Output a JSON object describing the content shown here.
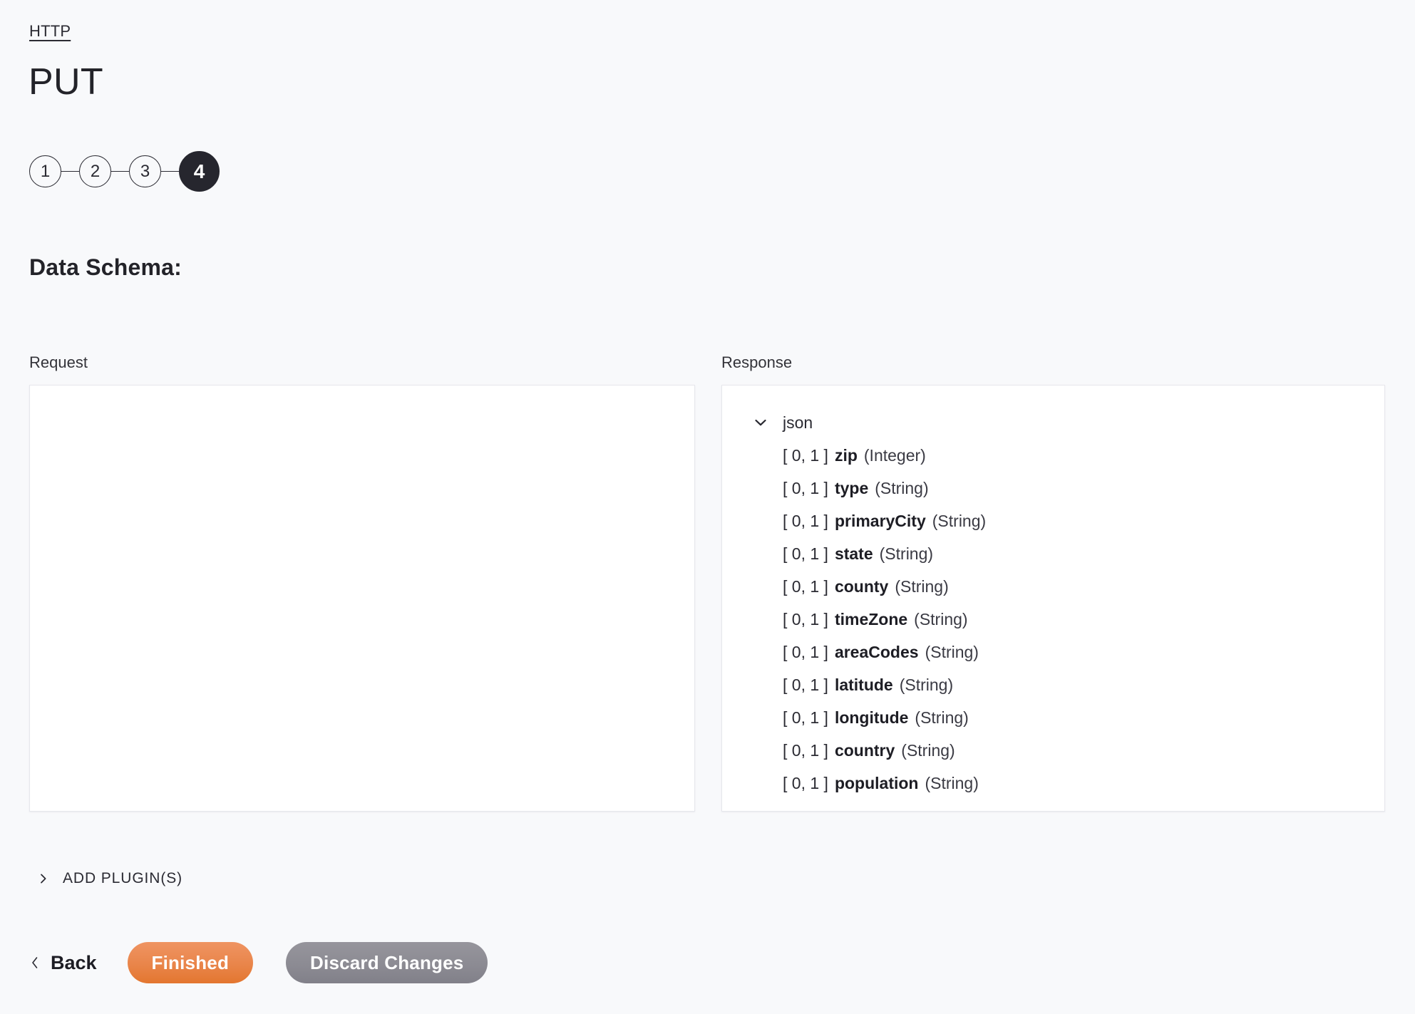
{
  "breadcrumb": {
    "label": "HTTP"
  },
  "page": {
    "title": "PUT"
  },
  "stepper": {
    "steps": [
      {
        "label": "1",
        "active": false
      },
      {
        "label": "2",
        "active": false
      },
      {
        "label": "3",
        "active": false
      },
      {
        "label": "4",
        "active": true
      }
    ]
  },
  "schema": {
    "heading": "Data Schema:",
    "request": {
      "label": "Request",
      "content": ""
    },
    "response": {
      "label": "Response",
      "root_label": "json",
      "root_icon": "chevron-down-icon",
      "fields": [
        {
          "cardinality": "[ 0, 1 ]",
          "name": "zip",
          "type": "(Integer)"
        },
        {
          "cardinality": "[ 0, 1 ]",
          "name": "type",
          "type": "(String)"
        },
        {
          "cardinality": "[ 0, 1 ]",
          "name": "primaryCity",
          "type": "(String)"
        },
        {
          "cardinality": "[ 0, 1 ]",
          "name": "state",
          "type": "(String)"
        },
        {
          "cardinality": "[ 0, 1 ]",
          "name": "county",
          "type": "(String)"
        },
        {
          "cardinality": "[ 0, 1 ]",
          "name": "timeZone",
          "type": "(String)"
        },
        {
          "cardinality": "[ 0, 1 ]",
          "name": "areaCodes",
          "type": "(String)"
        },
        {
          "cardinality": "[ 0, 1 ]",
          "name": "latitude",
          "type": "(String)"
        },
        {
          "cardinality": "[ 0, 1 ]",
          "name": "longitude",
          "type": "(String)"
        },
        {
          "cardinality": "[ 0, 1 ]",
          "name": "country",
          "type": "(String)"
        },
        {
          "cardinality": "[ 0, 1 ]",
          "name": "population",
          "type": "(String)"
        }
      ]
    }
  },
  "add_plugins": {
    "label": "ADD PLUGIN(S)",
    "icon": "chevron-right-icon"
  },
  "footer": {
    "back": {
      "label": "Back",
      "icon": "chevron-left-icon"
    },
    "finished": {
      "label": "Finished"
    },
    "discard": {
      "label": "Discard Changes"
    }
  },
  "colors": {
    "page_background": "#f8f9fb",
    "panel_background": "#ffffff",
    "panel_border": "#e6e7ec",
    "text_primary": "#2b2b33",
    "step_active_background": "#26262e",
    "finished_button": "#e9854a",
    "discard_button": "#8c8b93"
  }
}
